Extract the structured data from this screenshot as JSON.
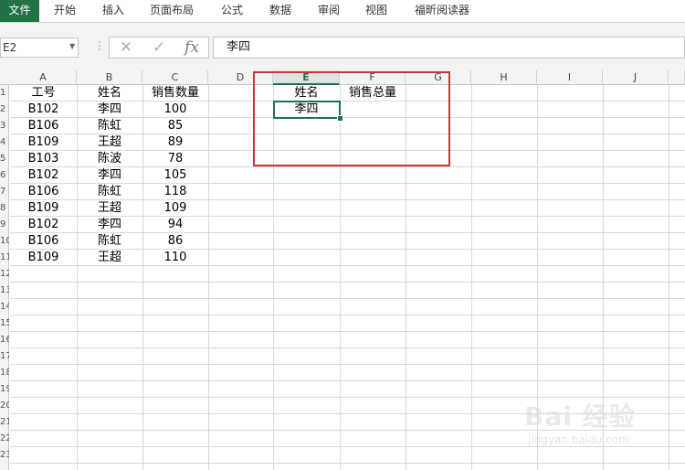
{
  "ribbon": {
    "tabs": [
      "文件",
      "开始",
      "插入",
      "页面布局",
      "公式",
      "数据",
      "审阅",
      "视图",
      "福昕阅读器"
    ]
  },
  "formula_bar": {
    "name_box": "E2",
    "cancel_icon": "x-icon",
    "enter_icon": "check-icon",
    "fx_label": "fx",
    "formula_value": "李四"
  },
  "columns": [
    "A",
    "B",
    "C",
    "D",
    "E",
    "F",
    "G",
    "H",
    "I",
    "J"
  ],
  "row_numbers": [
    "1",
    "2",
    "3",
    "4",
    "5",
    "6",
    "7",
    "8",
    "9",
    "10",
    "11",
    "12",
    "13",
    "14",
    "15",
    "16",
    "17",
    "18",
    "19",
    "20",
    "21",
    "22",
    "23"
  ],
  "table": {
    "headers": [
      "工号",
      "姓名",
      "销售数量"
    ],
    "rows": [
      [
        "B102",
        "李四",
        "100"
      ],
      [
        "B106",
        "陈虹",
        "85"
      ],
      [
        "B109",
        "王超",
        "89"
      ],
      [
        "B103",
        "陈波",
        "78"
      ],
      [
        "B102",
        "李四",
        "105"
      ],
      [
        "B106",
        "陈虹",
        "118"
      ],
      [
        "B109",
        "王超",
        "109"
      ],
      [
        "B102",
        "李四",
        "94"
      ],
      [
        "B106",
        "陈虹",
        "86"
      ],
      [
        "B109",
        "王超",
        "110"
      ]
    ]
  },
  "lookup": {
    "header_name": "姓名",
    "header_total": "销售总量",
    "name_value": "李四"
  },
  "selected_column": "E",
  "watermark": {
    "brand": "Bai 经验",
    "url": "jingyan.baidu.com"
  },
  "colors": {
    "excel_green": "#217346",
    "highlight_red": "#c0393b"
  }
}
